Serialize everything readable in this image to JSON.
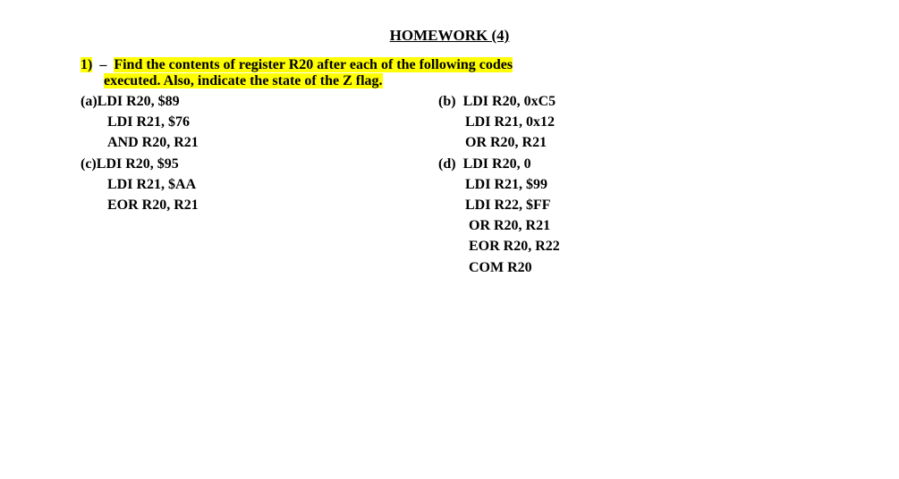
{
  "title": "HOMEWORK (4)",
  "question": {
    "number": "1)",
    "dash": "–",
    "line1": "Find the contents of register R20 after each of the following codes",
    "line2": "executed. Also, indicate the state of the Z flag."
  },
  "parts": {
    "a": {
      "label": "(a)",
      "lines": [
        "LDI R20, $89",
        "LDI R21, $76",
        "AND R20, R21"
      ]
    },
    "b": {
      "label": "(b)",
      "lines": [
        "LDI R20, 0xC5",
        "LDI R21, 0x12",
        "OR R20, R21"
      ]
    },
    "c": {
      "label": "(c)",
      "lines": [
        "LDI R20, $95",
        "LDI R21, $AA",
        "EOR R20, R21"
      ]
    },
    "d": {
      "label": "(d)",
      "lines": [
        "LDI R20, 0",
        "LDI R21, $99",
        "LDI R22, $FF",
        "OR R20, R21",
        "EOR R20, R22",
        "COM R20"
      ]
    }
  }
}
